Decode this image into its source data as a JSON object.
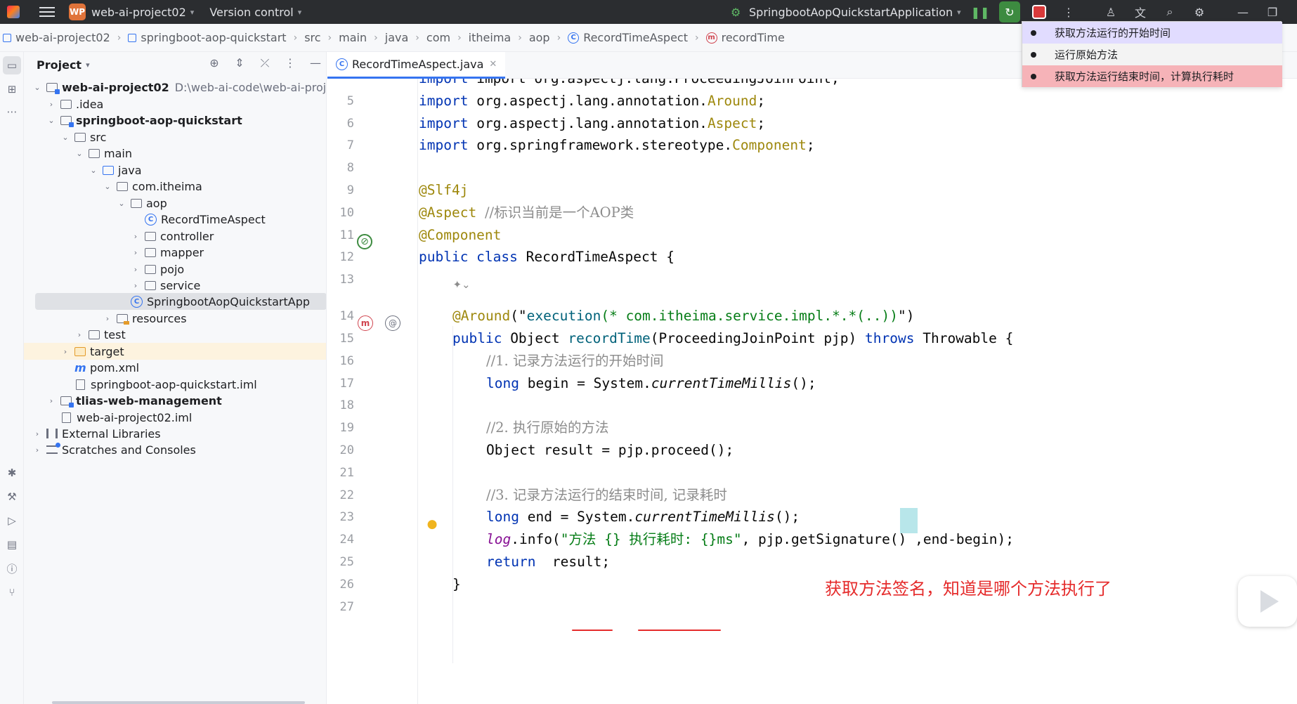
{
  "titlebar": {
    "project_badge": "WP",
    "project_name": "web-ai-project02",
    "version_control": "Version control",
    "run_config": "SpringbootAopQuickstartApplication",
    "logo_icon": "intellij-logo-icon",
    "icons": [
      "pause-icon",
      "rerun-icon",
      "stop-icon",
      "more-icon",
      "add-user-icon",
      "translate-icon",
      "search-icon",
      "settings-icon",
      "minimize-icon",
      "restore-icon"
    ]
  },
  "breadcrumb": [
    "web-ai-project02",
    "springboot-aop-quickstart",
    "src",
    "main",
    "java",
    "com",
    "itheima",
    "aop",
    "RecordTimeAspect",
    "recordTime"
  ],
  "project_panel": {
    "title": "Project",
    "tree": [
      {
        "label": "web-ai-project02",
        "path": "D:\\web-ai-code\\web-ai-proj"
      },
      {
        "label": ".idea"
      },
      {
        "label": "springboot-aop-quickstart"
      },
      {
        "label": "src"
      },
      {
        "label": "main"
      },
      {
        "label": "java"
      },
      {
        "label": "com.itheima"
      },
      {
        "label": "aop"
      },
      {
        "label": "RecordTimeAspect"
      },
      {
        "label": "controller"
      },
      {
        "label": "mapper"
      },
      {
        "label": "pojo"
      },
      {
        "label": "service"
      },
      {
        "label": "SpringbootAopQuickstartApp"
      },
      {
        "label": "resources"
      },
      {
        "label": "test"
      },
      {
        "label": "target"
      },
      {
        "label": "pom.xml"
      },
      {
        "label": "springboot-aop-quickstart.iml"
      },
      {
        "label": "tlias-web-management"
      },
      {
        "label": "web-ai-project02.iml"
      },
      {
        "label": "External Libraries"
      },
      {
        "label": "Scratches and Consoles"
      }
    ]
  },
  "editor": {
    "tab_label": "RecordTimeAspect.java",
    "line_numbers": [
      "5",
      "6",
      "7",
      "8",
      "9",
      "10",
      "11",
      "12",
      "13",
      "14",
      "15",
      "16",
      "17",
      "18",
      "19",
      "20",
      "21",
      "22",
      "23",
      "24",
      "25",
      "26",
      "27"
    ],
    "code": {
      "l4": "import org.aspectj.lang.ProceedingJoinPoint;",
      "l5_pkg": "org.aspectj.lang.annotation.",
      "l5_cls": "Around",
      "l6_pkg": "org.aspectj.lang.annotation.",
      "l6_cls": "Aspect",
      "l7_pkg": "org.springframework.stereotype.",
      "l7_cls": "Component",
      "import_kw": "import",
      "l9": "@Slf4j",
      "l10_ann": "@Aspect",
      "l10_cm": "//标识当前是一个AOP类",
      "l11": "@Component",
      "l12_kw": "public class",
      "l12_rest": " RecordTimeAspect {",
      "l14_ann": "@Around",
      "l14_fn": "execution",
      "l14_str": "(* com.itheima.service.impl.*.*(..))",
      "l15_kw": "public",
      "l15_type": " Object ",
      "l15_fn": "recordTime",
      "l15_params": "(ProceedingJoinPoint pjp) ",
      "l15_throws": "throws",
      "l15_rest": " Throwable {",
      "l16": "//1. 记录方法运行的开始时间",
      "l17_kw": "long",
      "l17_mid": " begin = System.",
      "l17_it": "currentTimeMillis",
      "l17_end": "();",
      "l19": "//2. 执行原始的方法",
      "l20": "Object result = pjp.proceed();",
      "l22": "//3. 记录方法运行的结束时间, 记录耗时",
      "l23_kw": "long",
      "l23_mid": " end = System.",
      "l23_it": "currentTimeMillis",
      "l23_end": "();",
      "l24_log": "log",
      "l24_a": ".info(",
      "l24_str": "\"方法 {} 执行耗时: {}ms\"",
      "l24_b": ", pjp.getSignature",
      "l24_paren": "()",
      "l24_c": " ,end-begin);",
      "l25_kw": "return",
      "l25_rest": "  result;",
      "l26": "}"
    },
    "annotation_note": "获取方法签名，知道是哪个方法执行了"
  },
  "notes_overlay": [
    "获取方法运行的开始时间",
    "运行原始方法",
    "获取方法运行结束时间，计算执行耗时"
  ]
}
